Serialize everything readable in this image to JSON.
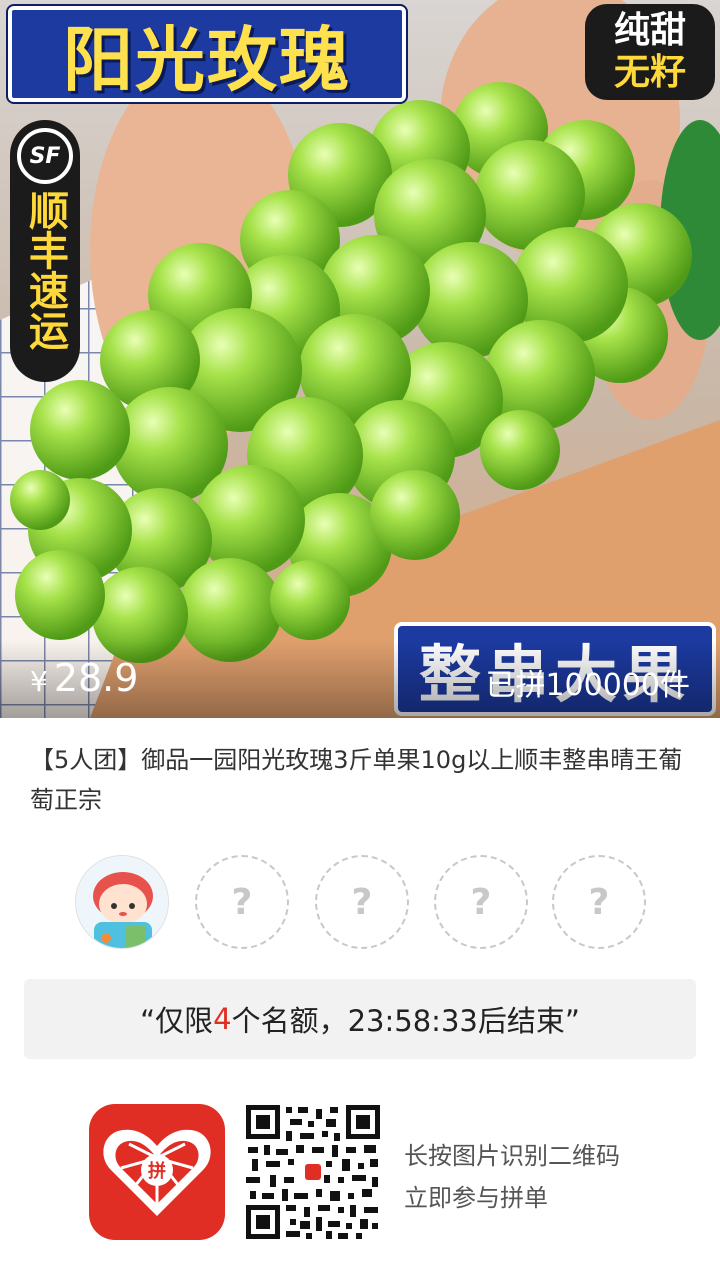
{
  "hero": {
    "title_banner": "阳光玫瑰",
    "tag_line1": "纯甜",
    "tag_line2": "无籽",
    "sf_logo": "SF",
    "sf_text": "顺丰速运",
    "bottom_banner": "整串大果",
    "price_symbol": "¥",
    "price": "28.9",
    "sold": "已拼100000件"
  },
  "product": {
    "title": "【5人团】御品一园阳光玫瑰3斤单果10g以上顺丰整串晴王葡萄正宗"
  },
  "group": {
    "slots": [
      {
        "type": "filled"
      },
      {
        "type": "empty",
        "label": "?"
      },
      {
        "type": "empty",
        "label": "?"
      },
      {
        "type": "empty",
        "label": "?"
      },
      {
        "type": "empty",
        "label": "?"
      }
    ]
  },
  "notice": {
    "prefix": "“仅限",
    "count": "4",
    "suffix": "个名额，23:58:33后结束”"
  },
  "footer": {
    "app_icon_text": "拼",
    "line1": "长按图片识别二维码",
    "line2": "立即参与拼单"
  },
  "colors": {
    "accent": "#e02e24",
    "banner_blue": "#1c3aa0",
    "grape_green": "#8fdc3a"
  }
}
